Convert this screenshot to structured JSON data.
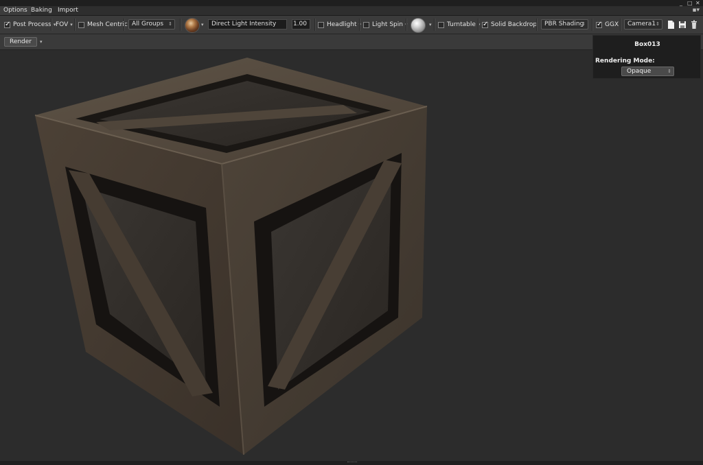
{
  "tabs": [
    {
      "label": "Options",
      "active": true
    },
    {
      "label": "Baking",
      "active": false
    },
    {
      "label": "Import",
      "active": false
    }
  ],
  "window_controls": {
    "minimize": "_",
    "maximize": "□",
    "close": "✕"
  },
  "toolbar": {
    "post_process": {
      "label": "Post Process",
      "checked": true
    },
    "fov": {
      "label": "FOV"
    },
    "mesh_centric": {
      "label": "Mesh Centric",
      "checked": false
    },
    "groups_select": {
      "value": "All Groups"
    },
    "light_intensity_field": {
      "value": "Direct Light Intensity"
    },
    "light_intensity_value": "1.00",
    "headlight": {
      "label": "Headlight",
      "checked": false
    },
    "light_spin": {
      "label": "Light Spin",
      "checked": false
    },
    "turntable": {
      "label": "Turntable",
      "checked": false
    },
    "solid_backdrop": {
      "label": "Solid Backdrop",
      "checked": true
    },
    "shading_select": {
      "value": "PBR Shading"
    },
    "ggx": {
      "label": "GGX",
      "checked": true
    },
    "camera_select": {
      "value": "Camera1"
    }
  },
  "subbar": {
    "render_label": "Render"
  },
  "panel": {
    "title": "Box013",
    "rendering_mode_label": "Rendering Mode:",
    "rendering_mode_value": "Opaque"
  },
  "icons": {
    "caret": "▾",
    "updown": "⇕",
    "menu": "▪▾"
  },
  "colors": {
    "viewport_bg": "#2c2c2c",
    "toolbar_bg": "#3b3b3b",
    "panel_bg": "#1e1e1e"
  }
}
